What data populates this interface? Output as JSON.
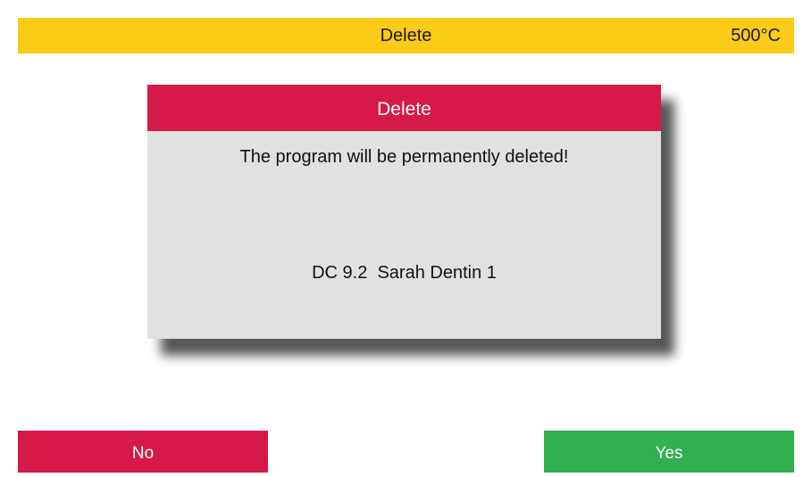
{
  "header": {
    "title": "Delete",
    "temperature": "500°C"
  },
  "dialog": {
    "title": "Delete",
    "message": "The program will be permanently deleted!",
    "program_name": "DC 9.2  Sarah Dentin 1"
  },
  "buttons": {
    "no_label": "No",
    "yes_label": "Yes"
  },
  "colors": {
    "header_bg": "#FCCB17",
    "dialog_title_bg": "#D61947",
    "dialog_bg": "#E1E1E1",
    "no_button_bg": "#D61947",
    "yes_button_bg": "#30B04F"
  }
}
